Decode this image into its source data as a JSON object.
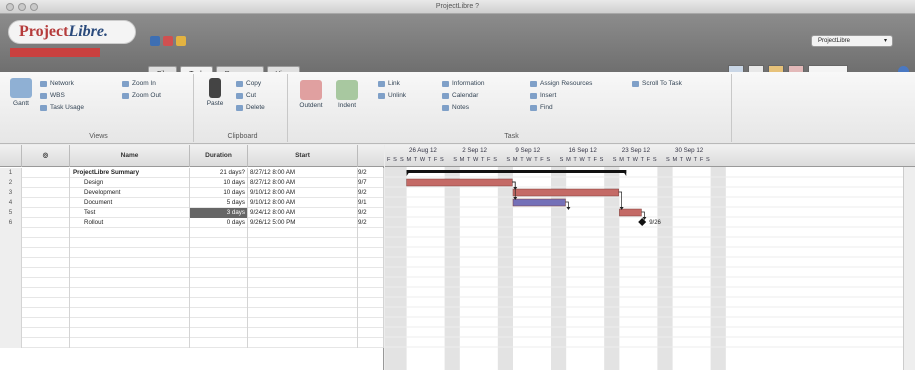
{
  "window": {
    "title": "ProjectLibre ?"
  },
  "branding": {
    "logo_a": "Project",
    "logo_b": "Libre.",
    "version_text": "",
    "tm": ""
  },
  "menu_tabs": [
    {
      "label": "File",
      "active": false
    },
    {
      "label": "Task",
      "active": true
    },
    {
      "label": "Resource",
      "active": false
    },
    {
      "label": "View",
      "active": false
    }
  ],
  "project_selector": {
    "value": "ProjectLibre"
  },
  "ribbon": {
    "views": {
      "label": "Views",
      "gantt": "Gantt",
      "items": [
        "Network",
        "WBS",
        "Task Usage",
        "Zoom In",
        "Zoom Out"
      ]
    },
    "clipboard": {
      "label": "Clipboard",
      "paste": "Paste",
      "items": [
        "Copy",
        "Cut",
        "Delete"
      ]
    },
    "task": {
      "label": "Task",
      "outdent": "Outdent",
      "indent": "Indent",
      "items": [
        "Link",
        "Unlink",
        "Information",
        "Calendar",
        "Notes",
        "Assign Resources",
        "Insert",
        "Find",
        "Scroll To Task"
      ]
    }
  },
  "table": {
    "headers": [
      "",
      "Name",
      "Duration",
      "Start",
      ""
    ],
    "rows": [
      {
        "num": "1",
        "name": "ProjectLibre Summary",
        "duration": "21 days?",
        "start": "8/27/12 8:00 AM",
        "end": "9/2",
        "bold": true
      },
      {
        "num": "2",
        "name": "Design",
        "duration": "10 days",
        "start": "8/27/12 8:00 AM",
        "end": "9/7",
        "bold": false
      },
      {
        "num": "3",
        "name": "Development",
        "duration": "10 days",
        "start": "9/10/12 8:00 AM",
        "end": "9/2",
        "bold": false
      },
      {
        "num": "4",
        "name": "Document",
        "duration": "5 days",
        "start": "9/10/12 8:00 AM",
        "end": "9/1",
        "bold": false
      },
      {
        "num": "5",
        "name": "Test",
        "duration": "3 days",
        "start": "9/24/12 8:00 AM",
        "end": "9/2",
        "bold": false,
        "selected": true
      },
      {
        "num": "6",
        "name": "Rollout",
        "duration": "0 days",
        "start": "9/26/12 5:00 PM",
        "end": "9/2",
        "bold": false
      }
    ],
    "empty_rows": 12
  },
  "gantt": {
    "weeks": [
      "26 Aug 12",
      "2 Sep 12",
      "9 Sep 12",
      "16 Sep 12",
      "23 Sep 12",
      "30 Sep 12"
    ],
    "day_letters": "S M T W T F S",
    "first_day": "F S",
    "milestone_label": "9/26",
    "bar_color": "#c46a66",
    "alt_bar_color": "#7470b8",
    "summary_color": "#111111",
    "bars": [
      {
        "row": 1,
        "start": 0,
        "end": 21,
        "kind": "summary"
      },
      {
        "row": 2,
        "start": 0,
        "end": 10,
        "kind": "task"
      },
      {
        "row": 3,
        "start": 10,
        "end": 20,
        "kind": "task"
      },
      {
        "row": 4,
        "start": 10,
        "end": 15,
        "kind": "alt"
      },
      {
        "row": 5,
        "start": 20,
        "end": 23,
        "kind": "task"
      },
      {
        "row": 6,
        "start": 23,
        "end": 23,
        "kind": "milestone"
      }
    ]
  }
}
